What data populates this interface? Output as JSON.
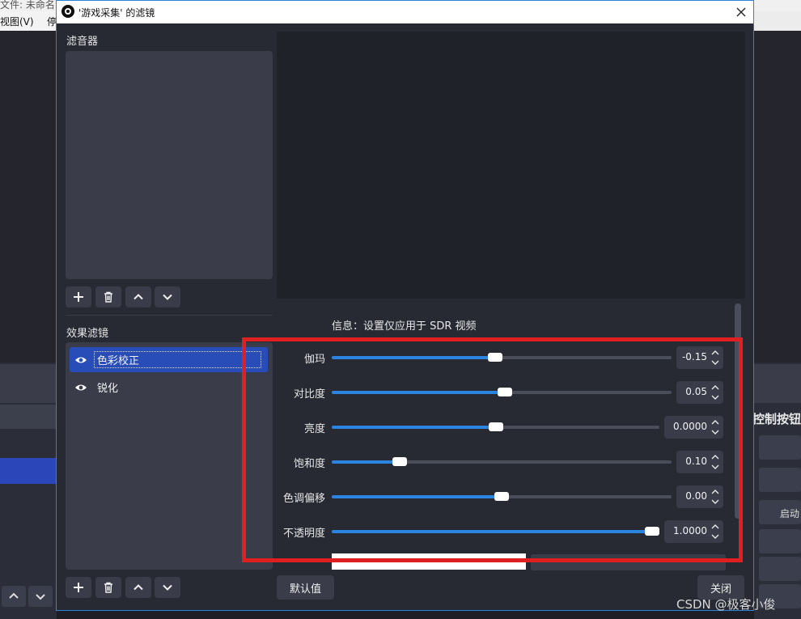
{
  "background": {
    "title_fragment": "文件: 未命名",
    "menu": {
      "view": "视图(V)",
      "stop": "停"
    },
    "controls_header": "控制按钮",
    "start_label": "启动",
    "watermark": "CSDN @极客小俊"
  },
  "dialog": {
    "title": "'游戏采集' 的滤镜",
    "close_icon": "close-icon",
    "audio_filters_label": "滤音器",
    "effect_filters_label": "效果滤镜",
    "effect_filters": [
      {
        "label": "色彩校正",
        "visible": true,
        "selected": true
      },
      {
        "label": "锐化",
        "visible": true,
        "selected": false
      }
    ],
    "toolbar_icons": [
      "plus-icon",
      "trash-icon",
      "chevron-up-icon",
      "chevron-down-icon"
    ],
    "info_text": "信息：设置仅应用于 SDR 视频",
    "properties": [
      {
        "label": "伽玛",
        "value": "-0.15",
        "level": 0.48
      },
      {
        "label": "对比度",
        "value": "0.05",
        "level": 0.51
      },
      {
        "label": "亮度",
        "value": "0.0000",
        "level": 0.5
      },
      {
        "label": "饱和度",
        "value": "0.10",
        "level": 0.2
      },
      {
        "label": "色调偏移",
        "value": "0.00",
        "level": 0.5
      },
      {
        "label": "不透明度",
        "value": "1.0000",
        "level": 1.0
      }
    ],
    "defaults_button": "默认值",
    "close_button": "关闭"
  },
  "colors": {
    "accent": "#2a84e0",
    "selection": "#284cb8",
    "highlight_border": "#e02020",
    "panel": "#3a3d49",
    "window_bg": "#272a33"
  }
}
